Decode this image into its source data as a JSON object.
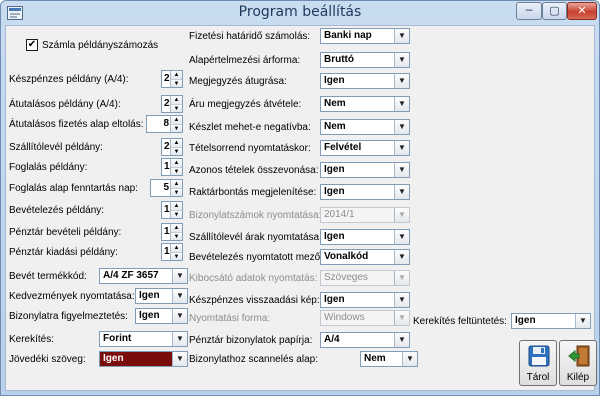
{
  "window": {
    "title": "Program beállítás",
    "min": "─",
    "max": "▢",
    "close": "✕"
  },
  "checkbox": {
    "label": "Számla példányszámozás",
    "checked": "✔"
  },
  "left_spinners": [
    {
      "label": "Készpénzes példány (A/4):",
      "value": "2"
    },
    {
      "label": "Átutalásos példány (A/4):",
      "value": "2"
    },
    {
      "label": "Átutalásos fizetés alap eltolás:",
      "value": "8"
    },
    {
      "label": "Szállítólevél példány:",
      "value": "2"
    },
    {
      "label": "Foglalás példány:",
      "value": "1"
    },
    {
      "label": "Foglalás alap fenntartás nap:",
      "value": "5"
    },
    {
      "label": "Bevételezés példány:",
      "value": "1"
    },
    {
      "label": "Pénztár bevételi példány:",
      "value": "1"
    },
    {
      "label": "Pénztár kiadási példány:",
      "value": "1"
    }
  ],
  "left_combos": [
    {
      "label": "Bevét termékkód:",
      "value": "A/4 ZF 3657"
    },
    {
      "label": "Kedvezmények nyomtatása:",
      "value": "Igen"
    },
    {
      "label": "Bizonylatra figyelmeztetés:",
      "value": "Igen"
    },
    {
      "label": "Kerekítés:",
      "value": "Forint"
    },
    {
      "label": "Jövedéki szöveg:",
      "value": "Igen"
    }
  ],
  "right_combos": [
    {
      "label": "Fizetési határidő számolás:",
      "value": "Banki nap",
      "disabled": false
    },
    {
      "label": "Alapértelmezési árforma:",
      "value": "Bruttó",
      "disabled": false
    },
    {
      "label": "Megjegyzés átugrása:",
      "value": "Igen",
      "disabled": false
    },
    {
      "label": "Áru megjegyzés átvétele:",
      "value": "Nem",
      "disabled": false
    },
    {
      "label": "Készlet mehet-e negatívba:",
      "value": "Nem",
      "disabled": false
    },
    {
      "label": "Tételsorrend nyomtatáskor:",
      "value": "Felvétel",
      "disabled": false
    },
    {
      "label": "Azonos tételek összevonása:",
      "value": "Igen",
      "disabled": false
    },
    {
      "label": "Raktárbontás megjelenítése:",
      "value": "Igen",
      "disabled": false
    },
    {
      "label": "Bizonylatszámok nyomtatása:",
      "value": "2014/1",
      "disabled": true
    },
    {
      "label": "Szállítólevél árak nyomtatása:",
      "value": "Igen",
      "disabled": false
    },
    {
      "label": "Bevételezés nyomtatott mező:",
      "value": "Vonalkód",
      "disabled": false
    },
    {
      "label": "Kibocsátó adatok nyomtatás:",
      "value": "Szöveges",
      "disabled": true
    },
    {
      "label": "Készpénzes visszaadási kép:",
      "value": "Igen",
      "disabled": false
    },
    {
      "label": "Nyomtatási forma:",
      "value": "Windows",
      "disabled": true
    },
    {
      "label": "Pénztár bizonylatok papírja:",
      "value": "A/4",
      "disabled": false
    }
  ],
  "scan": {
    "label": "Bizonylathoz scannelés alap:",
    "value": "Nem"
  },
  "rounding_display": {
    "label": "Kerekítés feltüntetés:",
    "value": "Igen"
  },
  "buttons": {
    "save": "Tárol",
    "exit": "Kilép"
  },
  "colors": {
    "dark_combo": "#7a0c0c",
    "title_text": "#1e395b"
  }
}
